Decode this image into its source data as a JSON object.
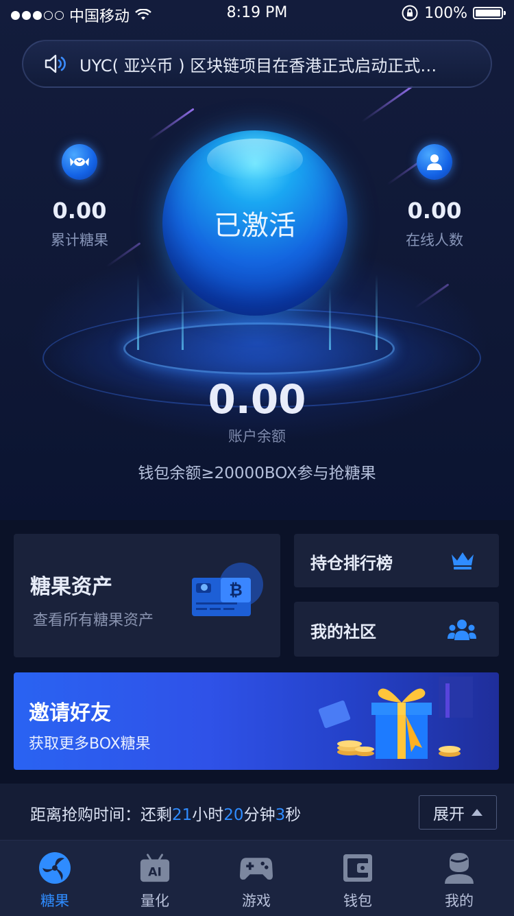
{
  "status_bar": {
    "carrier": "中国移动",
    "time": "8:19 PM",
    "battery": "100%"
  },
  "notice": {
    "text": "UYC( 亚兴币 ) 区块链项目在香港正式启动正式…"
  },
  "stats": {
    "left": {
      "value": "0.00",
      "label": "累计糖果",
      "icon": "candy-icon"
    },
    "right": {
      "value": "0.00",
      "label": "在线人数",
      "icon": "user-icon"
    }
  },
  "orb": {
    "label": "已激活"
  },
  "balance": {
    "value": "0.00",
    "label": "账户余额",
    "tip": "钱包余额≥20000BOX参与抢糖果"
  },
  "cards": {
    "candy_assets": {
      "title": "糖果资产",
      "subtitle": "查看所有糖果资产"
    },
    "ranking": {
      "title": "持仓排行榜"
    },
    "community": {
      "title": "我的社区"
    }
  },
  "invite": {
    "title": "邀请好友",
    "subtitle": "获取更多BOX糖果"
  },
  "countdown": {
    "prefix": "距离抢购时间：还剩",
    "hours": "21",
    "hours_unit": "小时",
    "minutes": "20",
    "minutes_unit": "分钟",
    "seconds": "3",
    "seconds_unit": "秒",
    "expand_label": "展开"
  },
  "tabs": [
    {
      "label": "糖果",
      "icon": "candy-swirl-icon",
      "active": true
    },
    {
      "label": "量化",
      "icon": "ai-robot-icon",
      "active": false
    },
    {
      "label": "游戏",
      "icon": "gamepad-icon",
      "active": false
    },
    {
      "label": "钱包",
      "icon": "wallet-icon",
      "active": false
    },
    {
      "label": "我的",
      "icon": "profile-icon",
      "active": false
    }
  ],
  "colors": {
    "accent": "#2f8cff",
    "background": "#0d1530",
    "card": "#1a223b",
    "invite_banner": "#2a63f2"
  }
}
